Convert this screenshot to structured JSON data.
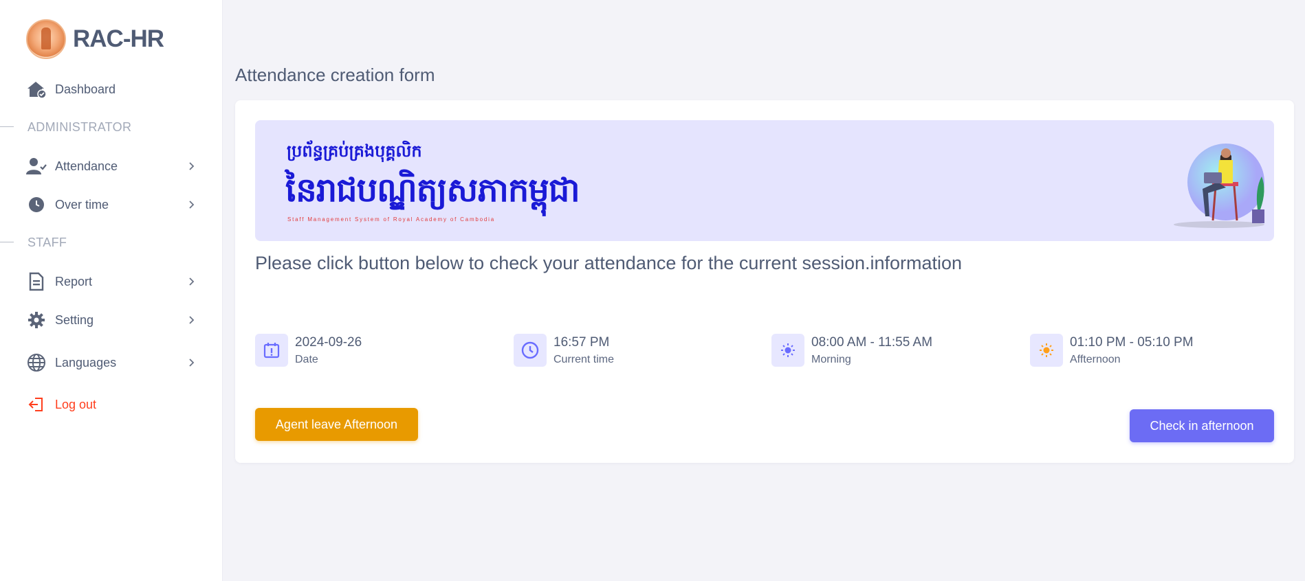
{
  "brand": {
    "name": "RAC-HR"
  },
  "sidebar": {
    "dashboard": "Dashboard",
    "section_admin": "ADMINISTRATOR",
    "attendance": "Attendance",
    "overtime": "Over time",
    "section_staff": "STAFF",
    "report": "Report",
    "setting": "Setting",
    "languages": "Languages",
    "logout": "Log out"
  },
  "page": {
    "title": "Attendance creation form",
    "instruction": "Please click button below to check your attendance for the current session.information"
  },
  "banner": {
    "line_small": "ប្រព័ន្ធគ្រប់គ្រងបុគ្គលិក",
    "line_big": "នៃរាជបណ្ឌិត្យសភាកម្ពុជា",
    "line_en": "Staff Management System of Royal Academy of Cambodia"
  },
  "info": {
    "date": {
      "value": "2024-09-26",
      "caption": "Date"
    },
    "time": {
      "value": "16:57 PM",
      "caption": "Current time"
    },
    "morning": {
      "value": "08:00 AM - 11:55 AM",
      "caption": "Morning"
    },
    "afternoon": {
      "value": "01:10 PM - 05:10 PM",
      "caption": "Affternoon"
    }
  },
  "buttons": {
    "leave": "Agent leave Afternoon",
    "check_in": "Check in afternoon"
  },
  "colors": {
    "accent": "#696cff",
    "warning": "#e89a00",
    "danger": "#ff3e1d",
    "banner_bg": "#e5e4fe"
  }
}
